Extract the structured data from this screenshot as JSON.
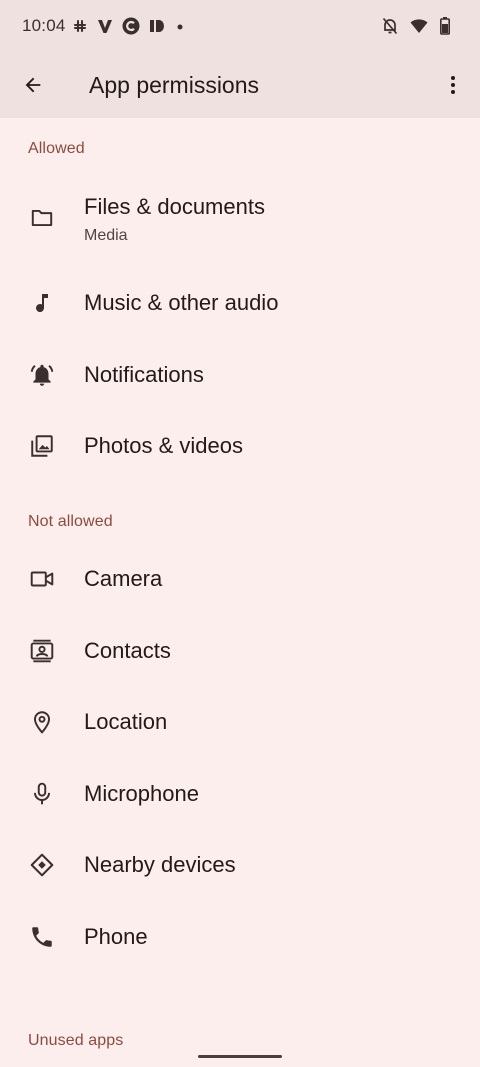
{
  "status_bar": {
    "time": "10:04",
    "left_icons": [
      "slack-icon",
      "v-icon",
      "c-circle-icon",
      "id-icon",
      "dot-icon"
    ],
    "right_icons": [
      "notifications-off-icon",
      "wifi-icon",
      "battery-icon"
    ]
  },
  "app_bar": {
    "title": "App permissions",
    "back_icon": "arrow-back-icon",
    "menu_icon": "more-vert-icon"
  },
  "sections": {
    "allowed": {
      "header": "Allowed",
      "items": [
        {
          "label": "Files & documents",
          "sublabel": "Media",
          "icon": "folder-icon"
        },
        {
          "label": "Music & other audio",
          "icon": "music-note-icon"
        },
        {
          "label": "Notifications",
          "icon": "notification-bell-icon"
        },
        {
          "label": "Photos & videos",
          "icon": "photo-library-icon"
        }
      ]
    },
    "not_allowed": {
      "header": "Not allowed",
      "items": [
        {
          "label": "Camera",
          "icon": "camera-icon"
        },
        {
          "label": "Contacts",
          "icon": "contacts-icon"
        },
        {
          "label": "Location",
          "icon": "location-pin-icon"
        },
        {
          "label": "Microphone",
          "icon": "microphone-icon"
        },
        {
          "label": "Nearby devices",
          "icon": "nearby-devices-icon"
        },
        {
          "label": "Phone",
          "icon": "phone-icon"
        }
      ]
    },
    "unused": {
      "header": "Unused apps"
    }
  },
  "colors": {
    "background": "#fbeeec",
    "app_bar": "#efe1df",
    "section_header": "#8f4a3f",
    "text_primary": "#231918",
    "icon": "#3a2f2e"
  }
}
